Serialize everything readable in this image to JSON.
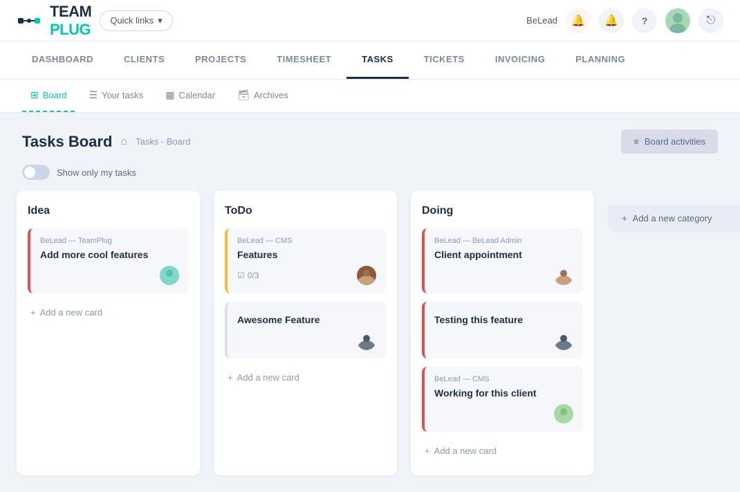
{
  "logo": {
    "text1": "TEAM",
    "text2": "PLUG"
  },
  "quicklinks": {
    "label": "Quick links"
  },
  "nav_right": {
    "user_name": "BeLead",
    "icons": [
      "🔔",
      "🔔",
      "?"
    ]
  },
  "main_tabs": [
    {
      "id": "dashboard",
      "label": "DASHBOARD"
    },
    {
      "id": "clients",
      "label": "CLIENTS"
    },
    {
      "id": "projects",
      "label": "PROJECTS"
    },
    {
      "id": "timesheet",
      "label": "TIMESHEET"
    },
    {
      "id": "tasks",
      "label": "TASKS"
    },
    {
      "id": "tickets",
      "label": "TICKETS"
    },
    {
      "id": "invoicing",
      "label": "INVOICING"
    },
    {
      "id": "planning",
      "label": "PLANNING"
    }
  ],
  "sub_tabs": [
    {
      "id": "board",
      "label": "Board",
      "icon": "⊞"
    },
    {
      "id": "your_tasks",
      "label": "Your tasks",
      "icon": "☰"
    },
    {
      "id": "calendar",
      "label": "Calendar",
      "icon": "📅"
    },
    {
      "id": "archives",
      "label": "Archives",
      "icon": "📁"
    }
  ],
  "page": {
    "title": "Tasks Board",
    "breadcrumb": "Tasks - Board",
    "board_activities_label": "Board activities"
  },
  "toggle": {
    "label": "Show only my tasks"
  },
  "columns": [
    {
      "id": "idea",
      "title": "Idea",
      "cards": [
        {
          "meta": "BeLead — TeamPlug",
          "title": "Add more cool features",
          "border": "red",
          "avatar_type": "teal",
          "has_checkbox": false
        }
      ],
      "add_label": "Add a new card"
    },
    {
      "id": "todo",
      "title": "ToDo",
      "cards": [
        {
          "meta": "BeLead — CMS",
          "title": "Features",
          "border": "yellow",
          "avatar_type": "brown",
          "has_checkbox": true,
          "checkbox_label": "0/3"
        },
        {
          "meta": "",
          "title": "Awesome Feature",
          "border": "none",
          "avatar_type": "dark",
          "has_checkbox": false
        }
      ],
      "add_label": "Add a new card"
    },
    {
      "id": "doing",
      "title": "Doing",
      "cards": [
        {
          "meta": "BeLead — BeLead Admin",
          "title": "Client appointment",
          "border": "red",
          "avatar_type": "brown",
          "has_checkbox": false
        },
        {
          "meta": "",
          "title": "Testing this feature",
          "border": "red",
          "avatar_type": "dark",
          "has_checkbox": false
        },
        {
          "meta": "BeLead — CMS",
          "title": "Working for this client",
          "border": "red",
          "avatar_type": "green2",
          "has_checkbox": false
        }
      ],
      "add_label": "Add a new card"
    }
  ],
  "add_category": {
    "label": "Add a new category"
  }
}
